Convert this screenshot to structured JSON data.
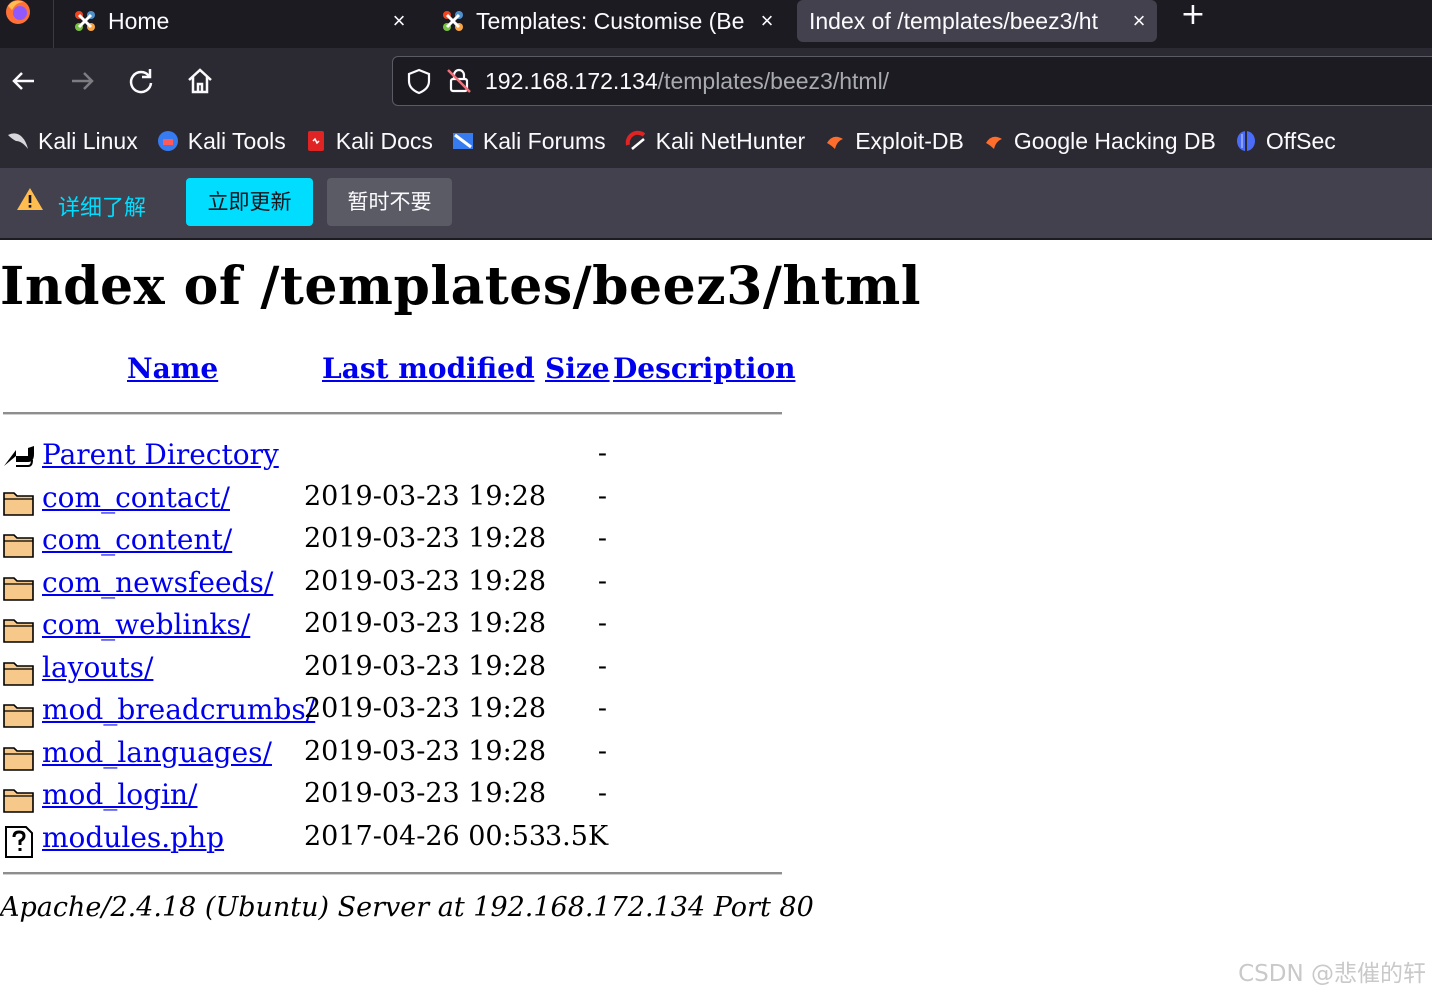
{
  "browser": {
    "tabs": [
      {
        "label": "Home",
        "icon": "joomla-icon"
      },
      {
        "label": "Templates: Customise (Be",
        "icon": "joomla-icon"
      },
      {
        "label": "Index of /templates/beez3/ht",
        "icon": "none",
        "active": true
      }
    ],
    "new_tab_label": "+",
    "close_glyph": "×",
    "url_host": "192.168.172.134",
    "url_path": "/templates/beez3/html/",
    "bookmarks": [
      {
        "label": "Kali Linux",
        "icon": "kali-dragon-icon"
      },
      {
        "label": "Kali Tools",
        "icon": "kali-tools-icon"
      },
      {
        "label": "Kali Docs",
        "icon": "kali-docs-icon"
      },
      {
        "label": "Kali Forums",
        "icon": "kali-forums-icon"
      },
      {
        "label": "Kali NetHunter",
        "icon": "kali-nethunter-icon"
      },
      {
        "label": "Exploit-DB",
        "icon": "exploit-db-icon"
      },
      {
        "label": "Google Hacking DB",
        "icon": "ghdb-icon"
      },
      {
        "label": "OffSec",
        "icon": "offsec-icon"
      }
    ]
  },
  "notification": {
    "learn_more": "详细了解",
    "update_now": "立即更新",
    "not_now": "暂时不要"
  },
  "listing": {
    "title": "Index of /templates/beez3/html",
    "columns": {
      "name": "Name",
      "last_modified": "Last modified",
      "size": "Size",
      "description": "Description"
    },
    "rows": [
      {
        "name": "Parent Directory",
        "date": "",
        "size": "-",
        "icon": "back-arrow-icon"
      },
      {
        "name": "com_contact/",
        "date": "2019-03-23 19:28",
        "size": "-",
        "icon": "folder-icon"
      },
      {
        "name": "com_content/",
        "date": "2019-03-23 19:28",
        "size": "-",
        "icon": "folder-icon"
      },
      {
        "name": "com_newsfeeds/",
        "date": "2019-03-23 19:28",
        "size": "-",
        "icon": "folder-icon"
      },
      {
        "name": "com_weblinks/",
        "date": "2019-03-23 19:28",
        "size": "-",
        "icon": "folder-icon"
      },
      {
        "name": "layouts/",
        "date": "2019-03-23 19:28",
        "size": "-",
        "icon": "folder-icon"
      },
      {
        "name": "mod_breadcrumbs/",
        "date": "2019-03-23 19:28",
        "size": "-",
        "icon": "folder-icon"
      },
      {
        "name": "mod_languages/",
        "date": "2019-03-23 19:28",
        "size": "-",
        "icon": "folder-icon"
      },
      {
        "name": "mod_login/",
        "date": "2019-03-23 19:28",
        "size": "-",
        "icon": "folder-icon"
      },
      {
        "name": "modules.php",
        "date": "2017-04-26 00:53",
        "size": "3.5K",
        "icon": "unknown-file-icon"
      }
    ],
    "address": "Apache/2.4.18 (Ubuntu) Server at 192.168.172.134 Port 80"
  },
  "watermark": "CSDN @悲催的轩",
  "colors": {
    "link": "#0000ee",
    "accent": "#00ddff",
    "chrome_dark": "#1c1b22",
    "chrome": "#2b2a33"
  }
}
